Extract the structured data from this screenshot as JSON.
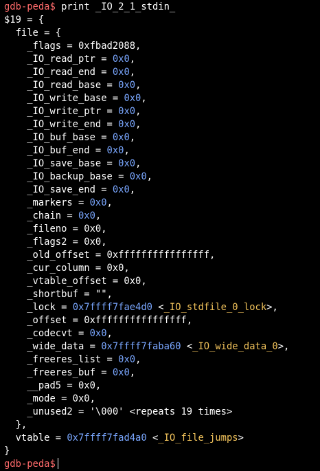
{
  "terminal": {
    "prompt": "gdb-peda$",
    "command": "print _IO_2_1_stdin_",
    "colors": {
      "background": "#000000",
      "text": "#ffffff",
      "prompt": "#ff6b6b",
      "address": "#7aa7ff",
      "symbol": "#f2c35b"
    },
    "lines": [
      [
        {
          "t": "p",
          "text": "gdb-peda$"
        },
        {
          "t": "c",
          "text": " print _IO_2_1_stdin_"
        }
      ],
      [
        {
          "t": "n",
          "text": "$19 = {"
        }
      ],
      [
        {
          "t": "n",
          "text": "  file = {"
        }
      ],
      [
        {
          "t": "n",
          "text": "    _flags = 0xfbad2088,"
        }
      ],
      [
        {
          "t": "n",
          "text": "    _IO_read_ptr = "
        },
        {
          "t": "a",
          "text": "0x0"
        },
        {
          "t": "n",
          "text": ","
        }
      ],
      [
        {
          "t": "n",
          "text": "    _IO_read_end = "
        },
        {
          "t": "a",
          "text": "0x0"
        },
        {
          "t": "n",
          "text": ","
        }
      ],
      [
        {
          "t": "n",
          "text": "    _IO_read_base = "
        },
        {
          "t": "a",
          "text": "0x0"
        },
        {
          "t": "n",
          "text": ","
        }
      ],
      [
        {
          "t": "n",
          "text": "    _IO_write_base = "
        },
        {
          "t": "a",
          "text": "0x0"
        },
        {
          "t": "n",
          "text": ","
        }
      ],
      [
        {
          "t": "n",
          "text": "    _IO_write_ptr = "
        },
        {
          "t": "a",
          "text": "0x0"
        },
        {
          "t": "n",
          "text": ","
        }
      ],
      [
        {
          "t": "n",
          "text": "    _IO_write_end = "
        },
        {
          "t": "a",
          "text": "0x0"
        },
        {
          "t": "n",
          "text": ","
        }
      ],
      [
        {
          "t": "n",
          "text": "    _IO_buf_base = "
        },
        {
          "t": "a",
          "text": "0x0"
        },
        {
          "t": "n",
          "text": ","
        }
      ],
      [
        {
          "t": "n",
          "text": "    _IO_buf_end = "
        },
        {
          "t": "a",
          "text": "0x0"
        },
        {
          "t": "n",
          "text": ","
        }
      ],
      [
        {
          "t": "n",
          "text": "    _IO_save_base = "
        },
        {
          "t": "a",
          "text": "0x0"
        },
        {
          "t": "n",
          "text": ","
        }
      ],
      [
        {
          "t": "n",
          "text": "    _IO_backup_base = "
        },
        {
          "t": "a",
          "text": "0x0"
        },
        {
          "t": "n",
          "text": ","
        }
      ],
      [
        {
          "t": "n",
          "text": "    _IO_save_end = "
        },
        {
          "t": "a",
          "text": "0x0"
        },
        {
          "t": "n",
          "text": ","
        }
      ],
      [
        {
          "t": "n",
          "text": "    _markers = "
        },
        {
          "t": "a",
          "text": "0x0"
        },
        {
          "t": "n",
          "text": ","
        }
      ],
      [
        {
          "t": "n",
          "text": "    _chain = "
        },
        {
          "t": "a",
          "text": "0x0"
        },
        {
          "t": "n",
          "text": ","
        }
      ],
      [
        {
          "t": "n",
          "text": "    _fileno = 0x0,"
        }
      ],
      [
        {
          "t": "n",
          "text": "    _flags2 = 0x0,"
        }
      ],
      [
        {
          "t": "n",
          "text": "    _old_offset = 0xffffffffffffffff,"
        }
      ],
      [
        {
          "t": "n",
          "text": "    _cur_column = 0x0,"
        }
      ],
      [
        {
          "t": "n",
          "text": "    _vtable_offset = 0x0,"
        }
      ],
      [
        {
          "t": "n",
          "text": "    _shortbuf = \"\","
        }
      ],
      [
        {
          "t": "n",
          "text": "    _lock = "
        },
        {
          "t": "a",
          "text": "0x7ffff7fae4d0"
        },
        {
          "t": "n",
          "text": " <"
        },
        {
          "t": "s",
          "text": "_IO_stdfile_0_lock"
        },
        {
          "t": "n",
          "text": ">,"
        }
      ],
      [
        {
          "t": "n",
          "text": "    _offset = 0xffffffffffffffff,"
        }
      ],
      [
        {
          "t": "n",
          "text": "    _codecvt = "
        },
        {
          "t": "a",
          "text": "0x0"
        },
        {
          "t": "n",
          "text": ","
        }
      ],
      [
        {
          "t": "n",
          "text": "    _wide_data = "
        },
        {
          "t": "a",
          "text": "0x7ffff7faba60"
        },
        {
          "t": "n",
          "text": " <"
        },
        {
          "t": "s",
          "text": "_IO_wide_data_0"
        },
        {
          "t": "n",
          "text": ">,"
        }
      ],
      [
        {
          "t": "n",
          "text": "    _freeres_list = "
        },
        {
          "t": "a",
          "text": "0x0"
        },
        {
          "t": "n",
          "text": ","
        }
      ],
      [
        {
          "t": "n",
          "text": "    _freeres_buf = "
        },
        {
          "t": "a",
          "text": "0x0"
        },
        {
          "t": "n",
          "text": ","
        }
      ],
      [
        {
          "t": "n",
          "text": "    __pad5 = 0x0,"
        }
      ],
      [
        {
          "t": "n",
          "text": "    _mode = 0x0,"
        }
      ],
      [
        {
          "t": "n",
          "text": "    _unused2 = '\\000' <repeats 19 times>"
        }
      ],
      [
        {
          "t": "n",
          "text": "  },"
        }
      ],
      [
        {
          "t": "n",
          "text": "  vtable = "
        },
        {
          "t": "a",
          "text": "0x7ffff7fad4a0"
        },
        {
          "t": "n",
          "text": " <"
        },
        {
          "t": "s",
          "text": "_IO_file_jumps"
        },
        {
          "t": "n",
          "text": ">"
        }
      ],
      [
        {
          "t": "n",
          "text": "}"
        }
      ],
      [
        {
          "t": "p",
          "text": "gdb-peda$"
        },
        {
          "t": "cursor",
          "text": ""
        }
      ]
    ]
  }
}
